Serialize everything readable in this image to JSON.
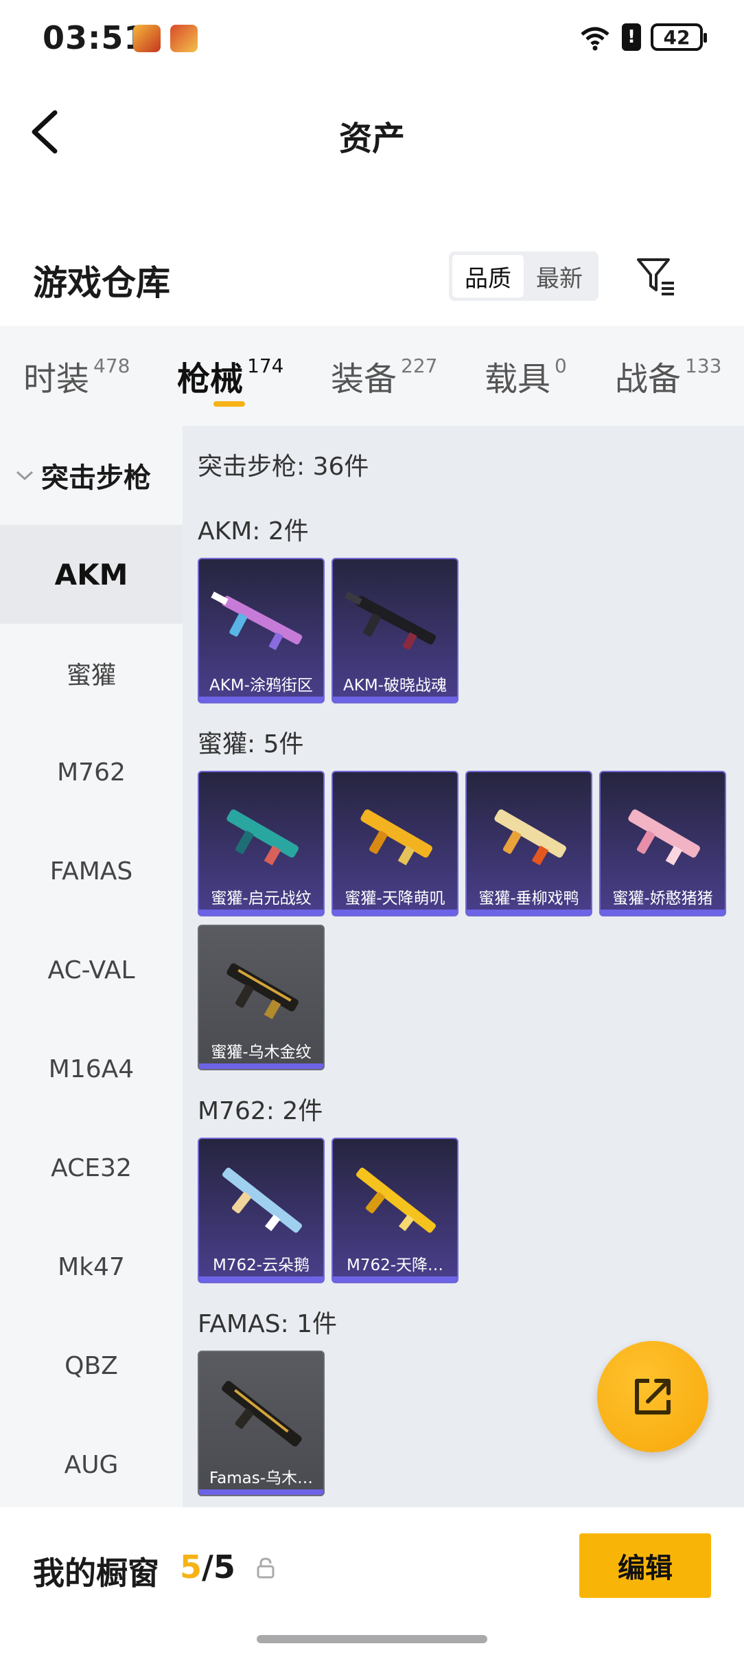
{
  "status_bar": {
    "time": "03:51",
    "battery": "42",
    "alert": "!"
  },
  "header": {
    "title": "资产"
  },
  "warehouse": {
    "title": "游戏仓库",
    "sort_options": [
      "品质",
      "最新"
    ],
    "selected_sort": "品质"
  },
  "tabs": [
    {
      "label": "时装",
      "count": "478"
    },
    {
      "label": "枪械",
      "count": "174",
      "active": true
    },
    {
      "label": "装备",
      "count": "227"
    },
    {
      "label": "载具",
      "count": "0"
    },
    {
      "label": "战备",
      "count": "133"
    }
  ],
  "sidebar": {
    "category": "突击步枪",
    "items": [
      "AKM",
      "蜜獾",
      "M762",
      "FAMAS",
      "AC-VAL",
      "M16A4",
      "ACE32",
      "Mk47",
      "QBZ",
      "AUG"
    ],
    "active": "AKM"
  },
  "content": {
    "summary": "突击步枪: 36件",
    "sections": [
      {
        "label": "AKM: 2件",
        "items": [
          "AKM-涂鸦街区",
          "AKM-破晓战魂"
        ]
      },
      {
        "label": "蜜獾: 5件",
        "items": [
          "蜜獾-启元战纹",
          "蜜獾-天降萌叽",
          "蜜獾-垂柳戏鸭",
          "蜜獾-娇憨猪猪",
          "蜜獾-乌木金纹"
        ]
      },
      {
        "label": "M762: 2件",
        "items": [
          "M762-云朵鹅",
          "M762-天降…"
        ]
      },
      {
        "label": "FAMAS: 1件",
        "items": [
          "Famas-乌木…"
        ]
      }
    ]
  },
  "colors": {
    "accent": "#f6b318",
    "card_purple": "#4a3f8c",
    "card_border": "#7168d6"
  },
  "bottom_bar": {
    "title": "我的橱窗",
    "count_current": "5",
    "count_sep": "/",
    "count_total": "5",
    "edit_label": "编辑"
  }
}
